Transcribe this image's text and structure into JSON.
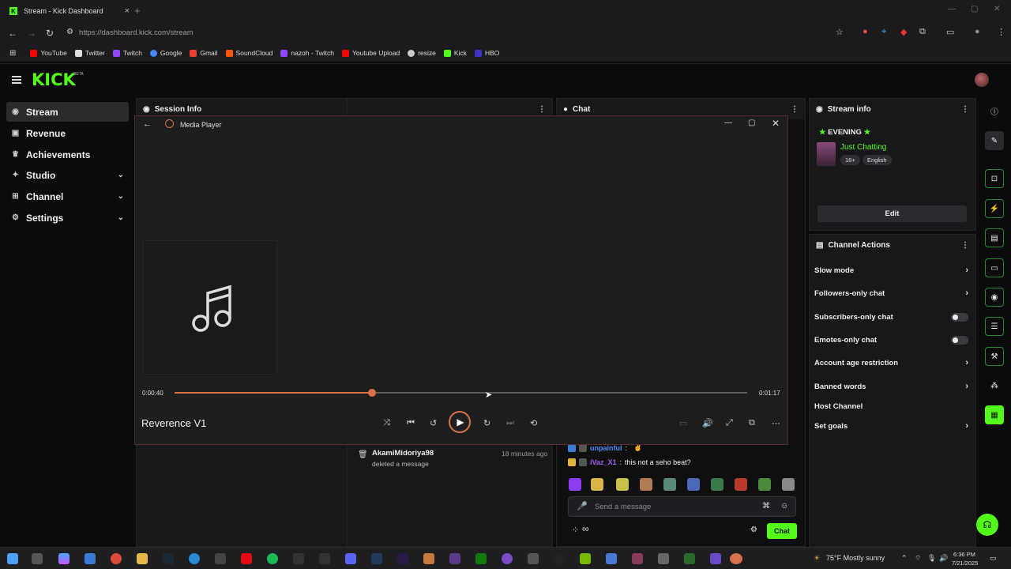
{
  "browser": {
    "tab_title": "Stream - Kick Dashboard",
    "tab_close": "×",
    "new_tab": "+",
    "url": "https://dashboard.kick.com/stream",
    "bookmarks": [
      {
        "label": "YouTube",
        "color": "#ff0000"
      },
      {
        "label": "Twitter",
        "color": "#dddddd"
      },
      {
        "label": "Twitch",
        "color": "#9146ff"
      },
      {
        "label": "Google",
        "color": "#4285f4"
      },
      {
        "label": "Gmail",
        "color": "#ea4335"
      },
      {
        "label": "SoundCloud",
        "color": "#ff5500"
      },
      {
        "label": "nazoh - Twitch",
        "color": "#9146ff"
      },
      {
        "label": "Youtube Upload",
        "color": "#ff0000"
      },
      {
        "label": "resize",
        "color": "#cccccc"
      },
      {
        "label": "Kick",
        "color": "#53fc18"
      },
      {
        "label": "HBO",
        "color": "#3a35c8"
      }
    ]
  },
  "kick": {
    "logo": "KICK",
    "beta": "BETA",
    "accent": "#53fc18"
  },
  "sidebar": {
    "items": [
      {
        "label": "Stream",
        "icon": "broadcast-icon",
        "glyph": "((·))",
        "chevron": false
      },
      {
        "label": "Revenue",
        "icon": "money-icon",
        "glyph": "▣",
        "chevron": false
      },
      {
        "label": "Achievements",
        "icon": "trophy-icon",
        "glyph": "♛",
        "chevron": false
      },
      {
        "label": "Studio",
        "icon": "studio-icon",
        "glyph": "⊹",
        "chevron": true
      },
      {
        "label": "Channel",
        "icon": "channel-icon",
        "glyph": "⊞",
        "chevron": true
      },
      {
        "label": "Settings",
        "icon": "gear-icon",
        "glyph": "⚙",
        "chevron": true
      }
    ]
  },
  "panels": {
    "session_info": "Session Info",
    "chat": "Chat",
    "stream_info": "Stream info",
    "channel_actions": "Channel Actions"
  },
  "player": {
    "title": "Media Player",
    "song": "Reverence V1",
    "elapsed": "0:00:40",
    "duration": "0:01:17",
    "progress": 0.345
  },
  "stream_info": {
    "title": "EVENING",
    "category": "Just Chatting",
    "tags": [
      "18+",
      "English"
    ],
    "edit_label": "Edit"
  },
  "channel_actions": [
    {
      "label": "Slow mode",
      "type": "chevron"
    },
    {
      "label": "Followers-only chat",
      "type": "chevron"
    },
    {
      "label": "Subscribers-only chat",
      "type": "toggle"
    },
    {
      "label": "Emotes-only chat",
      "type": "toggle"
    },
    {
      "label": "Account age restriction",
      "type": "chevron"
    },
    {
      "label": "Banned words",
      "type": "chevron"
    },
    {
      "label": "Host Channel",
      "type": "none"
    },
    {
      "label": "Set goals",
      "type": "chevron"
    }
  ],
  "session_log": {
    "user": "AkamiMidoriya98",
    "action": "deleted a message",
    "time": "18 minutes ago"
  },
  "chat": {
    "messages": [
      {
        "user": "unpainful",
        "text": "",
        "user_color": "#4f8ff7"
      },
      {
        "user": "iVaz_X1",
        "text": "this not a seho beat?",
        "user_color": "#a35cf0"
      }
    ],
    "placeholder": "Send a message",
    "send_label": "Chat",
    "infinity": "∞"
  },
  "taskbar": {
    "weather": "75°F  Mostly sunny",
    "time": "6:36 PM",
    "date": "7/21/2025"
  }
}
